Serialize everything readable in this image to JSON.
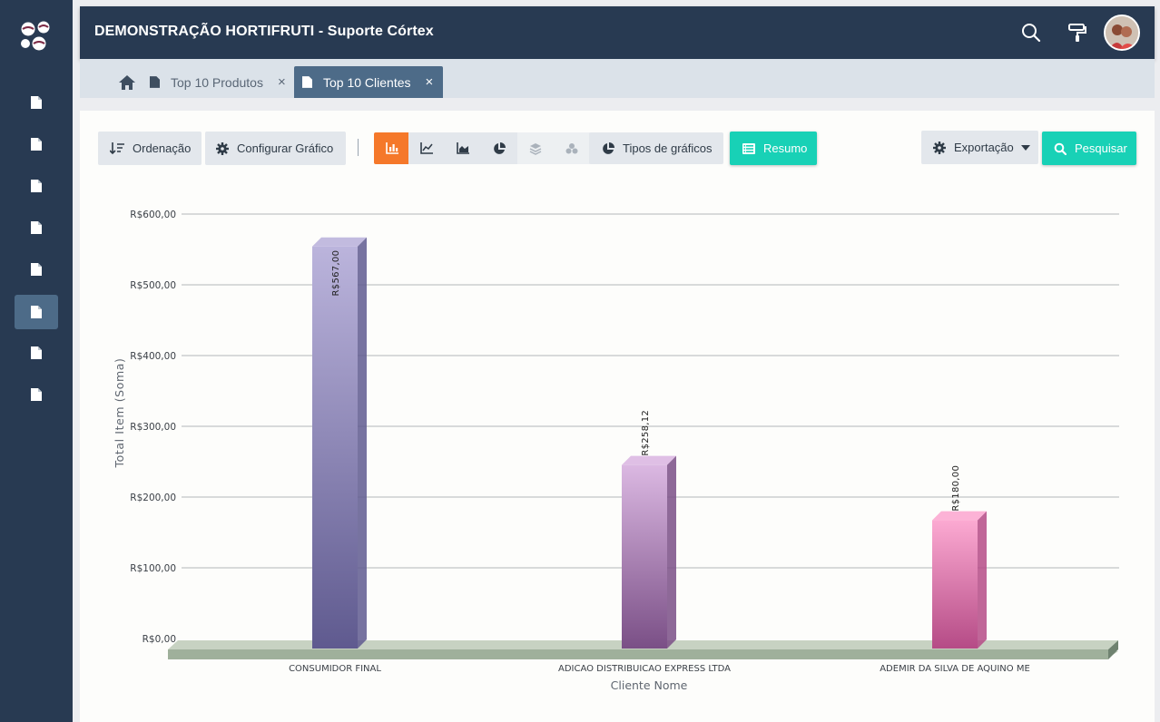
{
  "header": {
    "title": "DEMONSTRAÇÃO HORTIFRUTI - Suporte Córtex",
    "icons": [
      "search-icon",
      "paint-roller-icon",
      "avatar"
    ]
  },
  "sidebar": {
    "items": [
      {
        "icon": "document-icon",
        "active": false
      },
      {
        "icon": "document-icon",
        "active": false
      },
      {
        "icon": "document-icon",
        "active": false
      },
      {
        "icon": "document-icon",
        "active": false
      },
      {
        "icon": "document-icon",
        "active": false
      },
      {
        "icon": "document-icon",
        "active": true
      },
      {
        "icon": "document-icon",
        "active": false
      },
      {
        "icon": "document-icon",
        "active": false
      }
    ]
  },
  "tabs": [
    {
      "label": "Top 10 Produtos",
      "close": "×",
      "active": false
    },
    {
      "label": "Top 10 Clientes",
      "close": "×",
      "active": true
    }
  ],
  "toolbar": {
    "sort_label": "Ordenação",
    "config_label": "Configurar Gráfico",
    "chart_types_label": "Tipos de gráficos",
    "summary_label": "Resumo",
    "export_label": "Exportação",
    "search_label": "Pesquisar",
    "chart_type_buttons": [
      "bar-chart-icon",
      "line-chart-icon",
      "area-chart-icon",
      "pie-chart-icon",
      "stacked-layers-icon",
      "bubble-icon"
    ]
  },
  "colors": {
    "sidebar": "#283a52",
    "accent_orange": "#f5782a",
    "accent_teal": "#18d1b6",
    "tab_active": "#4d6b88"
  },
  "chart_data": {
    "type": "bar",
    "categories": [
      "CONSUMIDOR FINAL",
      "ADICAO DISTRIBUICAO EXPRESS LTDA",
      "ADEMIR DA SILVA DE AQUINO ME"
    ],
    "values": [
      567.0,
      258.12,
      180.0
    ],
    "data_labels": [
      "R$567,00",
      "R$258,12",
      "R$180,00"
    ],
    "bar_colors": [
      {
        "top": "#bbb4dc",
        "bottom": "#5f5a8f"
      },
      {
        "top": "#dbb8e2",
        "bottom": "#7a4f86"
      },
      {
        "top": "#fcaad2",
        "bottom": "#b54b86"
      }
    ],
    "xlabel": "Cliente Nome",
    "ylabel": "Total Item (Soma)",
    "yticks": [
      "R$0,00",
      "R$100,00",
      "R$200,00",
      "R$300,00",
      "R$400,00",
      "R$500,00",
      "R$600,00"
    ],
    "ylim": [
      0,
      600
    ],
    "grid": true,
    "style": "3d"
  }
}
